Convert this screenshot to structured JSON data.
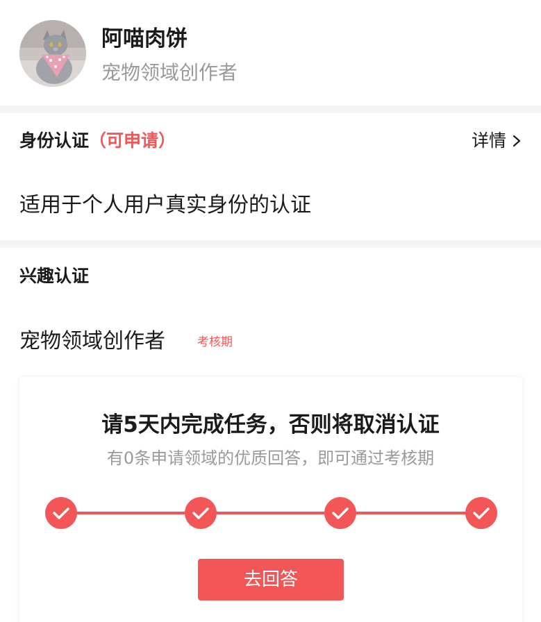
{
  "profile": {
    "name": "阿喵肉饼",
    "title": "宠物领域创作者"
  },
  "identity": {
    "title": "身份认证",
    "status": "（可申请）",
    "detail_label": "详情",
    "description": "适用于个人用户真实身份的认证"
  },
  "interest": {
    "title": "兴趣认证",
    "field": "宠物领域创作者",
    "badge": "考核期"
  },
  "task": {
    "heading": "请5天内完成任务，否则将取消认证",
    "subtext": "有0条申请领域的优质回答，即可通过考核期",
    "steps_completed": 4,
    "steps_total": 4,
    "button_label": "去回答"
  },
  "colors": {
    "accent": "#f25656",
    "text_primary": "#1a1a1a",
    "text_secondary": "#9a9a9a",
    "divider": "#f4f4f4"
  },
  "icons": {
    "detail": "chevron-right-icon",
    "step": "check-icon"
  }
}
